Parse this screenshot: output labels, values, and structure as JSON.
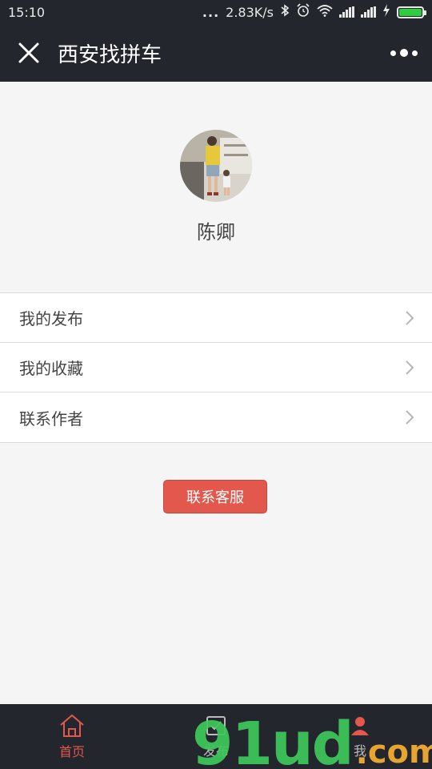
{
  "status_bar": {
    "time": "15:10",
    "dots": "...",
    "speed": "2.83K/s",
    "icons": [
      "bluetooth-icon",
      "alarm-icon",
      "wifi-icon",
      "signal-icon",
      "signal-icon",
      "charging-icon",
      "battery-icon"
    ]
  },
  "nav": {
    "title": "西安找拼车",
    "close_icon": "close-icon",
    "more_icon": "more-icon"
  },
  "profile": {
    "name": "陈卿"
  },
  "menu": {
    "items": [
      {
        "label": "我的发布",
        "icon": "chevron-right-icon"
      },
      {
        "label": "我的收藏",
        "icon": "chevron-right-icon"
      },
      {
        "label": "联系作者",
        "icon": "chevron-right-icon"
      }
    ]
  },
  "service_button": {
    "label": "联系客服"
  },
  "tabbar": {
    "tabs": [
      {
        "label": "首页",
        "icon": "home-icon",
        "active": true
      },
      {
        "label": "发布",
        "icon": "edit-icon",
        "active": false
      },
      {
        "label": "我",
        "icon": "user-icon",
        "active": false
      }
    ]
  },
  "watermark": {
    "main": "91ud",
    "dot": ".",
    "com": "com"
  },
  "colors": {
    "header_bg": "#23262d",
    "accent": "#e2584d",
    "page_bg": "#f5f5f5",
    "battery": "#2ecc40",
    "watermark_green": "#3ec95a",
    "watermark_orange": "#e8a431"
  }
}
